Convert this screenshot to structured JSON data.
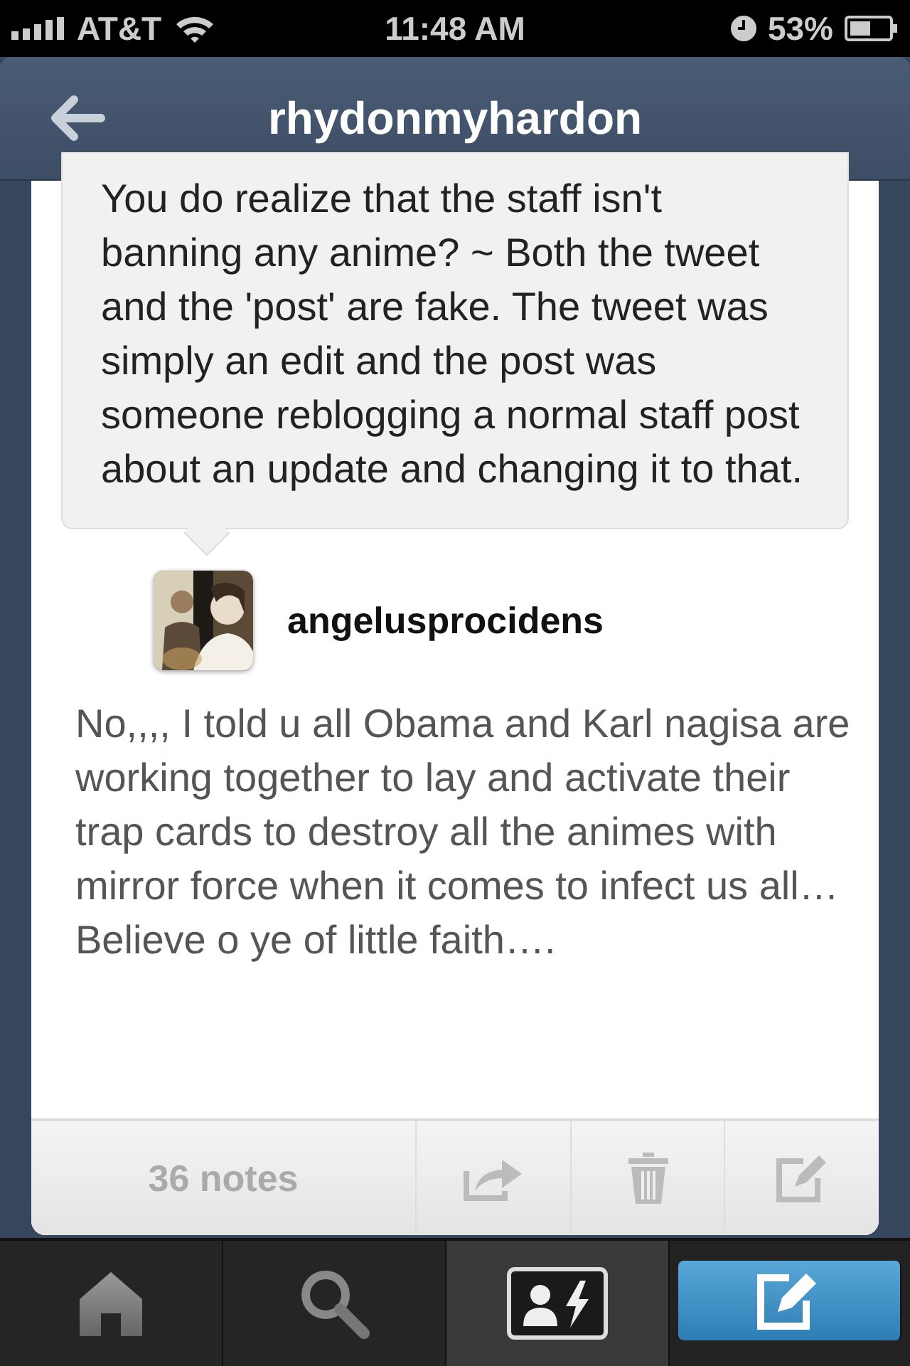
{
  "status_bar": {
    "carrier": "AT&T",
    "time": "11:48 AM",
    "battery": "53%"
  },
  "nav_bar": {
    "title": "rhydonmyhardon"
  },
  "post": {
    "quote": "You do realize that the staff isn't banning any anime? ~ Both the tweet and the 'post' are fake. The tweet was simply an edit and the post was someone reblogging a normal staff post about an update and changing it to that.",
    "author": {
      "name": "angelusprocidens"
    },
    "body": "No,,,, I told u all Obama and Karl nagisa are working together to lay and activate their trap cards to destroy all the animes with mirror force when it comes to infect us all… Believe o ye of little faith….",
    "notes": "36 notes"
  },
  "tab_bar": [
    {
      "kind": "home",
      "selected": false
    },
    {
      "kind": "search",
      "selected": false
    },
    {
      "kind": "activity",
      "selected": true
    },
    {
      "kind": "compose",
      "selected": false
    }
  ]
}
